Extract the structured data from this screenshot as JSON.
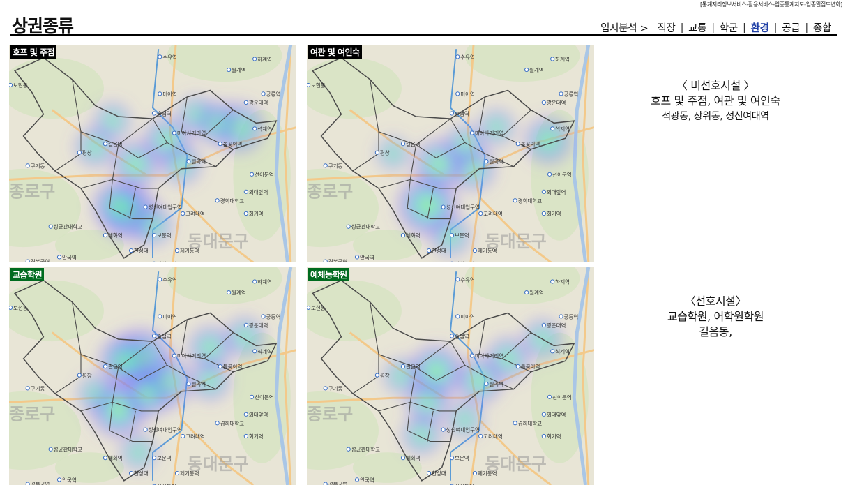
{
  "source": "[통계지리정보서비스-활용서비스-업종통계지도-업종밀집도변화]",
  "title": "상권종류",
  "nav": {
    "lead": "입지분석 >",
    "items": [
      {
        "label": "직장",
        "active": false
      },
      {
        "label": "교통",
        "active": false
      },
      {
        "label": "학군",
        "active": false
      },
      {
        "label": "환경",
        "active": true
      },
      {
        "label": "공급",
        "active": false
      },
      {
        "label": "종합",
        "active": false
      }
    ]
  },
  "maps": [
    {
      "label": "호프 및 주점",
      "label_color": "#000000",
      "blobs": [
        [
          0.42,
          0.77,
          0.55
        ],
        [
          0.38,
          0.74,
          0.45
        ],
        [
          0.55,
          0.44,
          0.4
        ],
        [
          0.8,
          0.38,
          0.45
        ],
        [
          0.72,
          0.36,
          0.35
        ],
        [
          0.44,
          0.55,
          0.4
        ],
        [
          0.6,
          0.55,
          0.3
        ],
        [
          0.5,
          0.83,
          0.3
        ],
        [
          0.3,
          0.47,
          0.3
        ],
        [
          0.36,
          0.35,
          0.25
        ],
        [
          0.65,
          0.32,
          0.25
        ]
      ]
    },
    {
      "label": "여관 및 여인숙",
      "label_color": "#000000",
      "blobs": [
        [
          0.42,
          0.74,
          0.6
        ],
        [
          0.46,
          0.55,
          0.45
        ],
        [
          0.58,
          0.57,
          0.35
        ],
        [
          0.84,
          0.44,
          0.4
        ],
        [
          0.55,
          0.46,
          0.3
        ],
        [
          0.66,
          0.38,
          0.25
        ],
        [
          0.5,
          0.88,
          0.3
        ],
        [
          0.3,
          0.5,
          0.2
        ]
      ]
    },
    {
      "label": "교습학원",
      "label_color": "#006b1f",
      "blobs": [
        [
          0.46,
          0.42,
          0.6
        ],
        [
          0.4,
          0.43,
          0.45
        ],
        [
          0.38,
          0.65,
          0.55
        ],
        [
          0.55,
          0.53,
          0.45
        ],
        [
          0.48,
          0.58,
          0.4
        ],
        [
          0.7,
          0.37,
          0.35
        ],
        [
          0.82,
          0.32,
          0.3
        ],
        [
          0.7,
          0.52,
          0.3
        ],
        [
          0.3,
          0.58,
          0.25
        ],
        [
          0.45,
          0.85,
          0.25
        ]
      ]
    },
    {
      "label": "예체능학원",
      "label_color": "#006b1f",
      "blobs": [
        [
          0.45,
          0.48,
          0.5
        ],
        [
          0.6,
          0.52,
          0.4
        ],
        [
          0.7,
          0.42,
          0.35
        ],
        [
          0.42,
          0.62,
          0.35
        ],
        [
          0.4,
          0.77,
          0.3
        ],
        [
          0.82,
          0.33,
          0.3
        ],
        [
          0.33,
          0.5,
          0.25
        ],
        [
          0.55,
          0.7,
          0.25
        ]
      ]
    }
  ],
  "map_text": {
    "district_west": "종로구",
    "district_east": "동대문구",
    "places": [
      "수유역",
      "미아역",
      "솔샘역",
      "미아사거리역",
      "길음역",
      "월곡역",
      "성신여대입구역",
      "고려대역",
      "보문역",
      "한성대",
      "혜화역",
      "성균관대학교",
      "경희대학교",
      "외대앞역",
      "회기역",
      "광운대역",
      "석계역",
      "돌곶이역",
      "선이문역",
      "제기동역",
      "신설동역",
      "용두역",
      "경복궁역",
      "안국역",
      "보현동",
      "구기동",
      "평창",
      "하계역",
      "월계역",
      "공릉역"
    ]
  },
  "descriptions": [
    {
      "head": "〈 비선호시설 〉",
      "lines": [
        "호프 및 주점, 여관 및 여인숙",
        "석광동, 장위동, 성신여대역"
      ]
    },
    {
      "head": "〈선호시설〉",
      "lines": [
        "교습학원, 어학원학원",
        "길음동,"
      ]
    }
  ]
}
